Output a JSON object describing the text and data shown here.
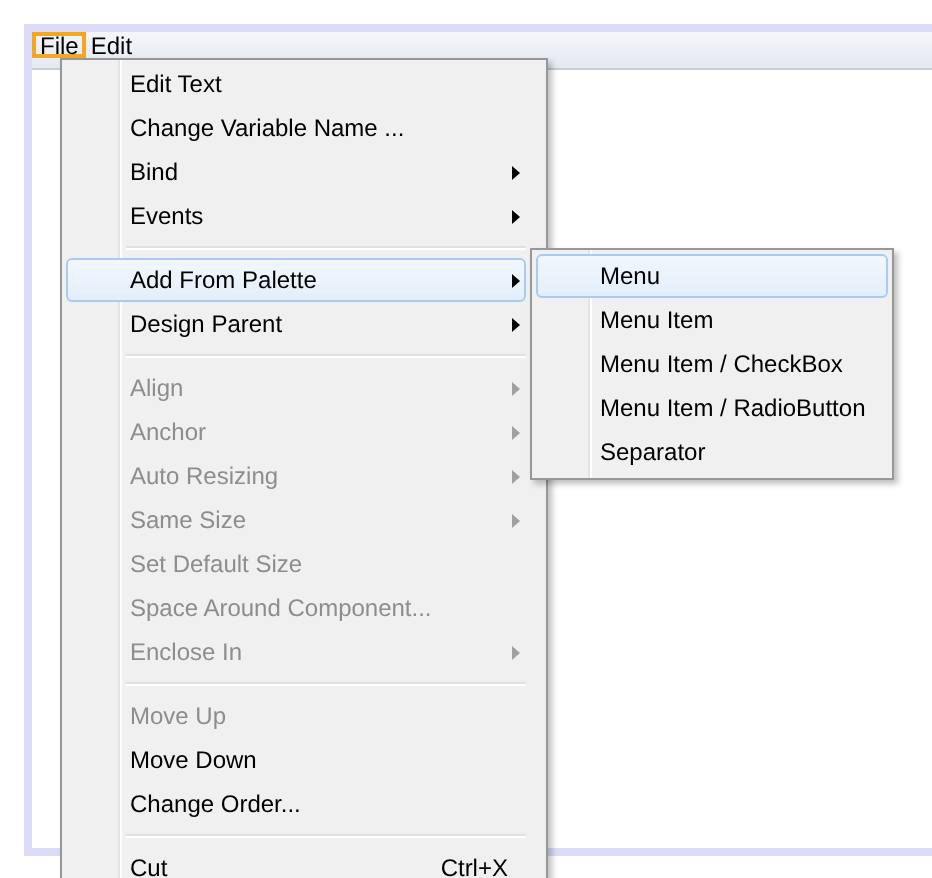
{
  "menu_bar": [
    {
      "label": "File",
      "selected": true
    },
    {
      "label": "Edit",
      "selected": false
    }
  ],
  "context_menu": [
    {
      "kind": "item",
      "label": "Edit Text",
      "disabled": false,
      "submenu": false,
      "selected": false
    },
    {
      "kind": "item",
      "label": "Change Variable Name ...",
      "disabled": false,
      "submenu": false,
      "selected": false
    },
    {
      "kind": "item",
      "label": "Bind",
      "disabled": false,
      "submenu": true,
      "selected": false
    },
    {
      "kind": "item",
      "label": "Events",
      "disabled": false,
      "submenu": true,
      "selected": false
    },
    {
      "kind": "separator"
    },
    {
      "kind": "item",
      "label": "Add From Palette",
      "disabled": false,
      "submenu": true,
      "selected": true
    },
    {
      "kind": "item",
      "label": "Design Parent",
      "disabled": false,
      "submenu": true,
      "selected": false
    },
    {
      "kind": "separator"
    },
    {
      "kind": "item",
      "label": "Align",
      "disabled": true,
      "submenu": true,
      "selected": false
    },
    {
      "kind": "item",
      "label": "Anchor",
      "disabled": true,
      "submenu": true,
      "selected": false
    },
    {
      "kind": "item",
      "label": "Auto Resizing",
      "disabled": true,
      "submenu": true,
      "selected": false
    },
    {
      "kind": "item",
      "label": "Same Size",
      "disabled": true,
      "submenu": true,
      "selected": false
    },
    {
      "kind": "item",
      "label": "Set Default Size",
      "disabled": true,
      "submenu": false,
      "selected": false
    },
    {
      "kind": "item",
      "label": "Space Around Component...",
      "disabled": true,
      "submenu": false,
      "selected": false
    },
    {
      "kind": "item",
      "label": "Enclose In",
      "disabled": true,
      "submenu": true,
      "selected": false
    },
    {
      "kind": "separator"
    },
    {
      "kind": "item",
      "label": "Move Up",
      "disabled": true,
      "submenu": false,
      "selected": false
    },
    {
      "kind": "item",
      "label": "Move Down",
      "disabled": false,
      "submenu": false,
      "selected": false
    },
    {
      "kind": "item",
      "label": "Change Order...",
      "disabled": false,
      "submenu": false,
      "selected": false
    },
    {
      "kind": "separator"
    },
    {
      "kind": "item",
      "label": "Cut",
      "shortcut": "Ctrl+X",
      "disabled": false,
      "submenu": false,
      "selected": false
    }
  ],
  "submenu": [
    {
      "label": "Menu",
      "selected": true
    },
    {
      "label": "Menu Item",
      "selected": false
    },
    {
      "label": "Menu Item / CheckBox",
      "selected": false
    },
    {
      "label": "Menu Item / RadioButton",
      "selected": false
    },
    {
      "label": "Separator",
      "selected": false
    }
  ]
}
